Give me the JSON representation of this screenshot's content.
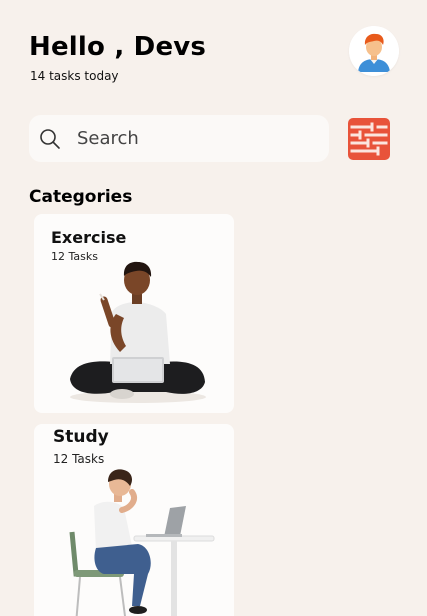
{
  "header": {
    "greeting": "Hello , Devs",
    "subtitle": "14 tasks today"
  },
  "search": {
    "placeholder": "Search",
    "icon": "search-icon"
  },
  "filter": {
    "icon": "filter-icon",
    "color": "#e8533a"
  },
  "categories": {
    "title": "Categories",
    "items": [
      {
        "title": "Exercise",
        "count": "12 Tasks"
      },
      {
        "title": "Study",
        "count": "12 Tasks"
      }
    ]
  },
  "colors": {
    "background": "#f7f1ec",
    "card": "#fdfcfb",
    "accent": "#e8533a"
  }
}
